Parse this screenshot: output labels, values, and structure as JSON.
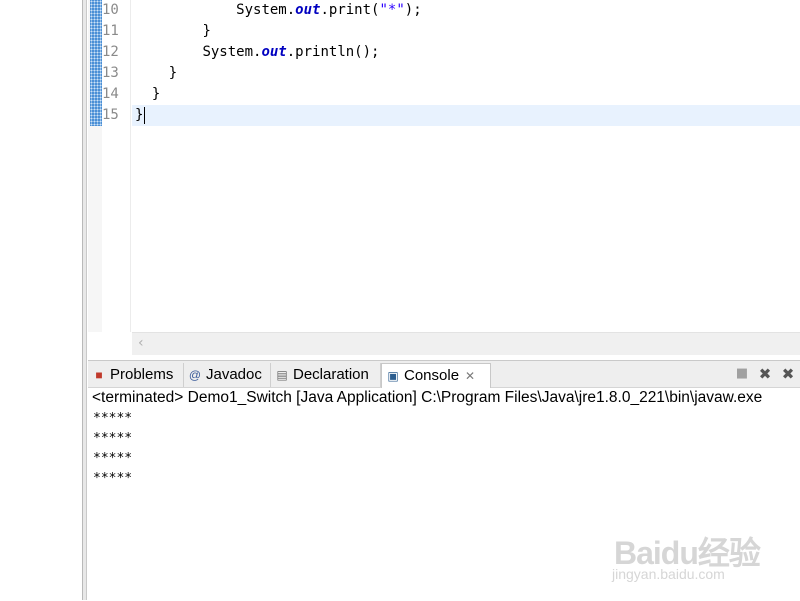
{
  "editor": {
    "lines": [
      {
        "num": "10",
        "indent": "            ",
        "parts": [
          [
            "",
            "System."
          ],
          [
            "field",
            "out"
          ],
          [
            "",
            ".print("
          ],
          [
            "str",
            "\"*\""
          ],
          [
            "",
            ");"
          ]
        ]
      },
      {
        "num": "11",
        "indent": "        ",
        "parts": [
          [
            "",
            "}"
          ]
        ]
      },
      {
        "num": "12",
        "indent": "        ",
        "parts": [
          [
            "",
            "System."
          ],
          [
            "field",
            "out"
          ],
          [
            "",
            ".println();"
          ]
        ]
      },
      {
        "num": "13",
        "indent": "    ",
        "parts": [
          [
            "",
            "}"
          ]
        ]
      },
      {
        "num": "14",
        "indent": "  ",
        "parts": [
          [
            "",
            "}"
          ]
        ]
      },
      {
        "num": "15",
        "indent": "",
        "parts": [
          [
            "",
            "}"
          ]
        ]
      }
    ],
    "current_line": "15"
  },
  "console": {
    "tabs": [
      {
        "label": "Problems",
        "icon": "problems-icon"
      },
      {
        "label": "Javadoc",
        "icon": "javadoc-icon"
      },
      {
        "label": "Declaration",
        "icon": "declaration-icon"
      },
      {
        "label": "Console",
        "icon": "console-icon",
        "active": true
      }
    ],
    "toolbar": [
      "terminate-icon",
      "remove-launch-icon",
      "remove-all-icon"
    ],
    "status": "<terminated> Demo1_Switch [Java Application] C:\\Program Files\\Java\\jre1.8.0_221\\bin\\javaw.exe",
    "output": [
      "*****",
      "*****",
      "*****",
      "*****"
    ]
  },
  "watermark": {
    "logo": "Baidu经验",
    "url": "jingyan.baidu.com"
  },
  "colors": {
    "current_line": "#e8f2fe",
    "field": "#0000c0",
    "string": "#2a00ff",
    "marker": "#4a8fd6"
  }
}
